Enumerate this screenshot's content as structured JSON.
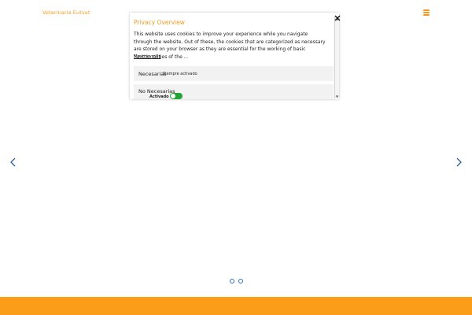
{
  "header": {
    "site_name": "Veterinaria Eutvet",
    "menu_icon": "hamburger-menu-icon"
  },
  "slider": {
    "prev_icon": "chevron-left-icon",
    "next_icon": "chevron-right-icon",
    "dots_count": 2,
    "accent_color": "#2d6cc1"
  },
  "cookie_modal": {
    "title": "Privacy Overview",
    "description": "This website uses cookies to improve your experience while you navigate through the website. Out of these, the cookies that are categorized as necessary are stored on your browser as they are essential for the working of basic functionalities of the ...",
    "show_more": "Mostrar más",
    "necessary": {
      "label": "Necesarias",
      "status": "Siempre activado"
    },
    "non_necessary": {
      "label": "No Necesarias",
      "toggle_label": "Activado",
      "enabled": true
    },
    "close_icon": "close-icon"
  },
  "colors": {
    "brand_orange": "#fb9d19",
    "toggle_green": "#21a336"
  }
}
